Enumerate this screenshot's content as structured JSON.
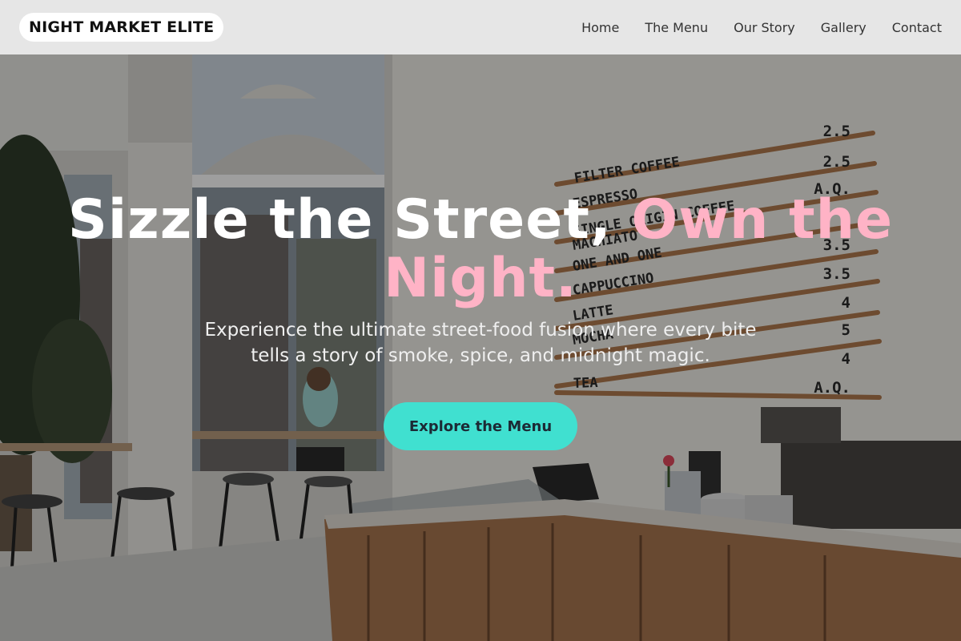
{
  "brand": {
    "name": "NIGHT MARKET ELITE"
  },
  "nav": {
    "items": [
      {
        "label": "Home"
      },
      {
        "label": "The Menu"
      },
      {
        "label": "Our Story"
      },
      {
        "label": "Gallery"
      },
      {
        "label": "Contact"
      }
    ]
  },
  "hero": {
    "headline_main": "Sizzle the Street,",
    "headline_accent": "Own the Night.",
    "subtitle": "Experience the ultimate street-food fusion where every bite tells a story of smoke, spice, and midnight magic.",
    "cta_label": "Explore the Menu",
    "menu_board": {
      "items": [
        {
          "name": "FILTER COFFEE",
          "price": "2.5"
        },
        {
          "name": "ESPRESSO",
          "price": "2.5"
        },
        {
          "name": "SINGLE ORIGIN COFFEE",
          "price": "A.Q."
        },
        {
          "name": "MACHIATO",
          "price": "3.5"
        },
        {
          "name": "ONE AND ONE",
          "price": "3.5"
        },
        {
          "name": "CAPPUCCINO",
          "price": "4"
        },
        {
          "name": "LATTE",
          "price": "5"
        },
        {
          "name": "MOCHA",
          "price": "4"
        },
        {
          "name": "TEA",
          "price": "A.Q."
        }
      ]
    }
  },
  "colors": {
    "header_bg": "#e6e6e6",
    "accent_pink": "#ffb3c6",
    "cta_teal": "#40e0d0",
    "text_white": "#ffffff"
  }
}
